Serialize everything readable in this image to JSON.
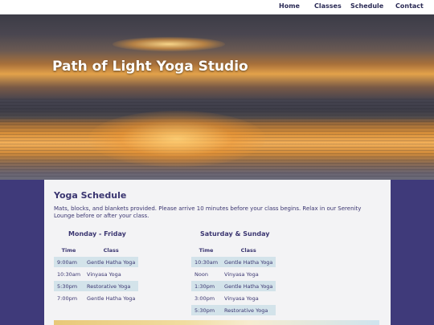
{
  "nav": {
    "home": "Home",
    "classes": "Classes",
    "schedule": "Schedule",
    "contact": "Contact"
  },
  "hero": {
    "title": "Path of Light Yoga Studio"
  },
  "content": {
    "heading": "Yoga Schedule",
    "intro": "Mats, blocks, and blankets provided. Please arrive 10 minutes before your class begins. Relax in our Serenity Lounge before or after your class."
  },
  "weekday": {
    "heading": "Monday - Friday",
    "col_time": "Time",
    "col_class": "Class",
    "rows": [
      {
        "time": "9:00am",
        "class": "Gentle Hatha Yoga"
      },
      {
        "time": "10:30am",
        "class": "Vinyasa Yoga"
      },
      {
        "time": "5:30pm",
        "class": "Restorative Yoga"
      },
      {
        "time": "7:00pm",
        "class": "Gentle Hatha Yoga"
      }
    ]
  },
  "weekend": {
    "heading": "Saturday & Sunday",
    "col_time": "Time",
    "col_class": "Class",
    "rows": [
      {
        "time": "10:30am",
        "class": "Gentle Hatha Yoga"
      },
      {
        "time": "Noon",
        "class": "Vinyasa Yoga"
      },
      {
        "time": "1:30pm",
        "class": "Gentle Hatha Yoga"
      },
      {
        "time": "3:00pm",
        "class": "Vinyasa Yoga"
      },
      {
        "time": "5:30pm",
        "class": "Restorative Yoga"
      }
    ]
  },
  "colors": {
    "page_background": "#3f3a7a",
    "text": "#3a3570",
    "row_shade": "#d3e3ea"
  }
}
